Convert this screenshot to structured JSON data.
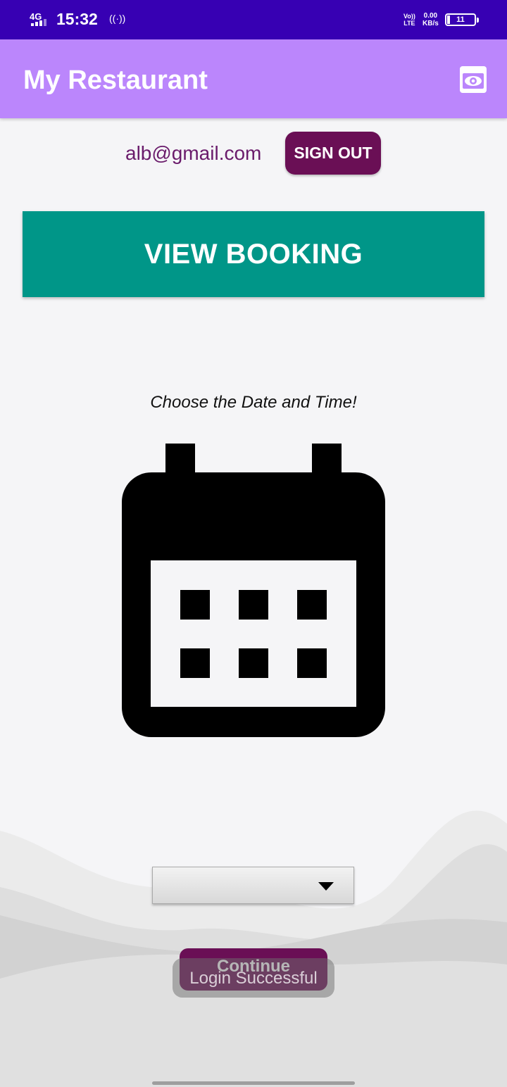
{
  "status_bar": {
    "network": "4G",
    "time": "15:32",
    "hotspot_icon": "hotspot-icon",
    "volte_top": "Vo))",
    "volte_bottom": "LTE",
    "speed_value": "0.00",
    "speed_unit": "KB/s",
    "battery": "11"
  },
  "app_bar": {
    "title": "My Restaurant",
    "action_icon": "eye-icon"
  },
  "account": {
    "email": "alb@gmail.com",
    "sign_out_label": "SIGN OUT"
  },
  "main": {
    "view_booking_label": "VIEW BOOKING",
    "prompt": "Choose the Date and Time!",
    "calendar_icon": "calendar-icon",
    "dropdown_value": "",
    "continue_label": "Continue"
  },
  "toast": {
    "message": "Login Successful"
  },
  "colors": {
    "status_bar": "#3700b3",
    "app_bar": "#bb86fc",
    "accent_button": "#6a0f55",
    "view_booking": "#009688",
    "email_text": "#6a1b6b"
  }
}
